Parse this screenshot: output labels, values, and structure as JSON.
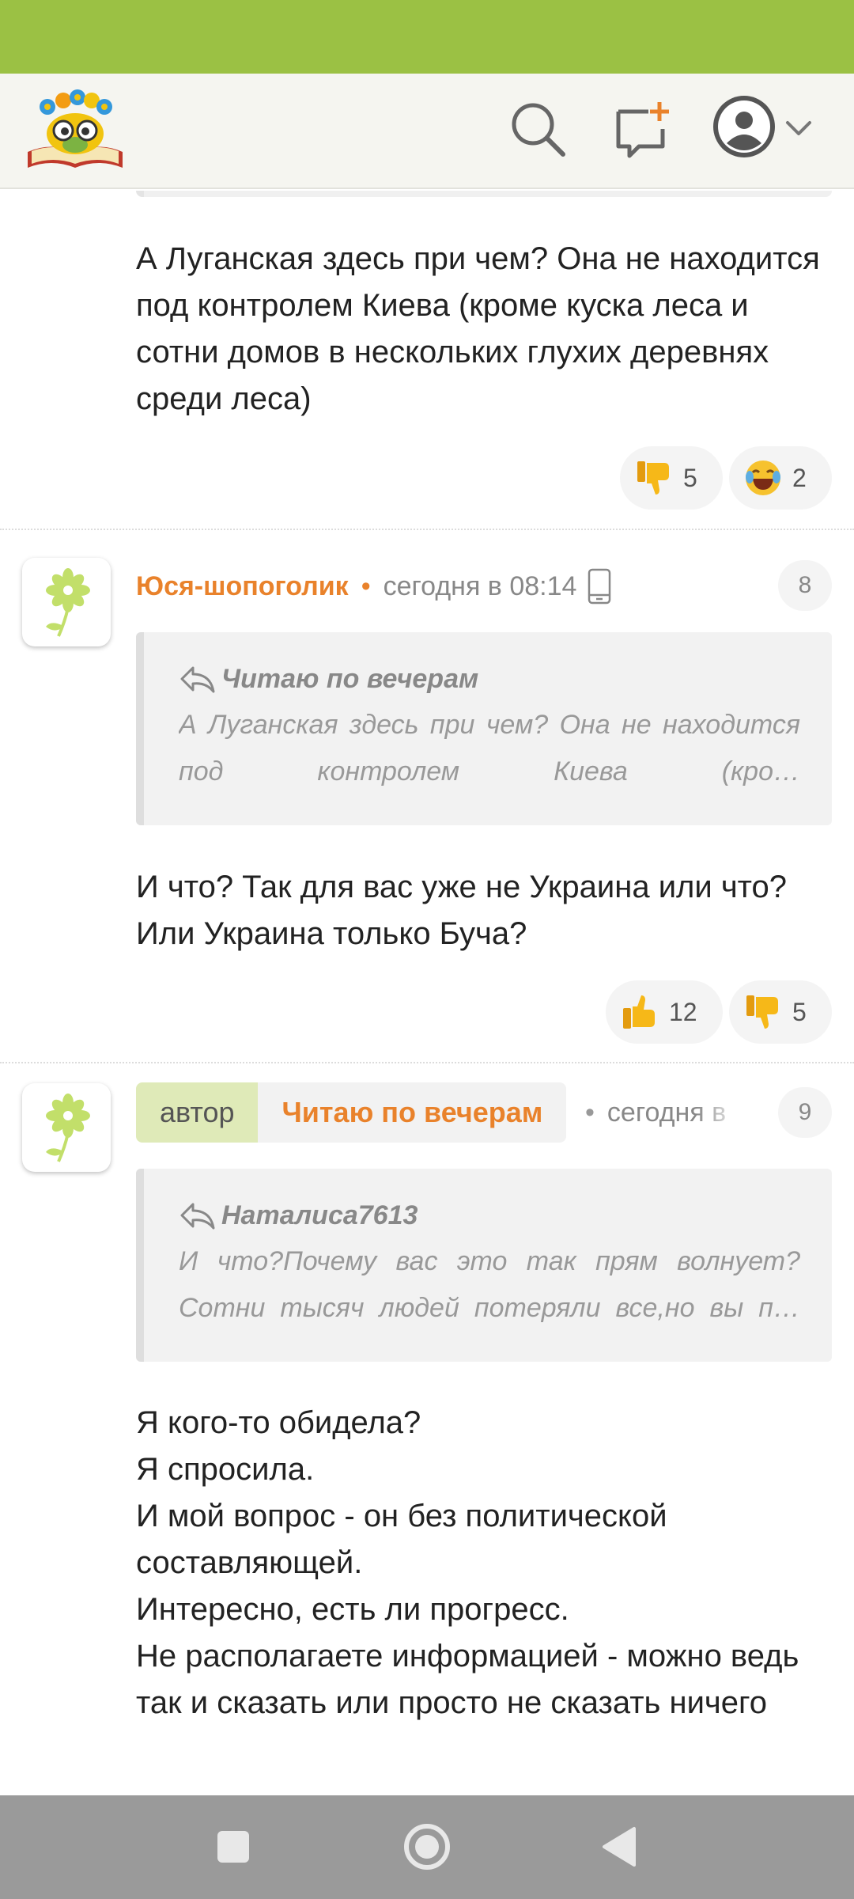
{
  "colors": {
    "status_bar": "#9bc144",
    "accent": "#e9822b",
    "author_tag_bg": "#dfeab8",
    "nav_bar": "#9a9a9a"
  },
  "header": {
    "logo": "owl-reading-book-logo",
    "icons": [
      "search-icon",
      "new-message-icon",
      "user-avatar-icon",
      "chevron-down-icon"
    ]
  },
  "comments": [
    {
      "text": "А Луганская здесь при чем? Она не находится под контролем Киева (кроме куска леса и сотни домов в нескольких глухих деревнях среди леса)",
      "reactions": [
        {
          "icon": "thumbs-down-icon",
          "count": "5"
        },
        {
          "icon": "laughing-emoji-icon",
          "count": "2"
        }
      ]
    },
    {
      "author": "Юся-шопоголик",
      "time": "сегодня в 08:14",
      "number": "8",
      "quote": {
        "author": "Читаю по вечерам",
        "text": "А Луганская здесь при чем? Она не находится под контролем Киева (кро…"
      },
      "text": "И что? Так для вас уже не Украина или что? Или Украина только Буча?",
      "reactions": [
        {
          "icon": "thumbs-up-icon",
          "count": "12"
        },
        {
          "icon": "thumbs-down-icon",
          "count": "5"
        }
      ]
    },
    {
      "author_tag": "автор",
      "author": "Читаю по вечерам",
      "time": "сегодня в",
      "number": "9",
      "quote": {
        "author": "Наталиса7613",
        "text": "И что?Почему вас это так прям волнует? Сотни тысяч людей потеряли все,но вы п…"
      },
      "text": "Я кого-то обидела?\nЯ спросила.\nИ мой вопрос - он без политической составляющей.\nИнтересно, есть ли прогресс.\nНе располагаете информацией - можно ведь так и сказать или просто не сказать ничего"
    }
  ],
  "nav": {
    "icons": [
      "recent-apps-icon",
      "home-icon",
      "back-icon"
    ]
  }
}
